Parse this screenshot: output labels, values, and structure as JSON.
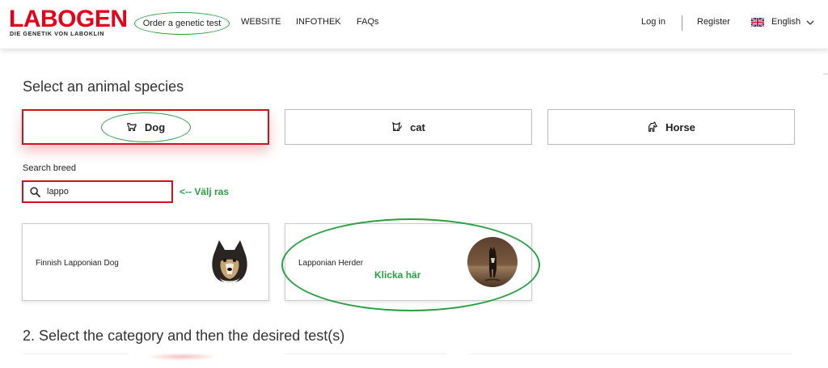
{
  "header": {
    "logo_main": "LABOGEN",
    "logo_sub": "DIE GENETIK VON LABOKLIN",
    "nav": {
      "order": "Order a genetic test",
      "website": "WEBSITE",
      "infothek": "INFOTHEK",
      "faqs": "FAQs"
    },
    "login": "Log in",
    "register": "Register",
    "language": "English"
  },
  "species": {
    "title": "Select an animal species",
    "items": [
      {
        "label": "Dog",
        "icon": "dog-icon"
      },
      {
        "label": "cat",
        "icon": "cat-icon"
      },
      {
        "label": "Horse",
        "icon": "horse-icon"
      }
    ],
    "selected": "Dog"
  },
  "search": {
    "label": "Search breed",
    "value": "lappo",
    "annotation": "<-- Välj ras"
  },
  "breeds": [
    {
      "name": "Finnish Lapponian Dog"
    },
    {
      "name": "Lapponian Herder",
      "annotation": "Klicka här"
    }
  ],
  "section2_title": "2. Select the category and then the desired test(s)",
  "colors": {
    "brand_red": "#e3001b",
    "annotation_green": "#2aa043"
  }
}
